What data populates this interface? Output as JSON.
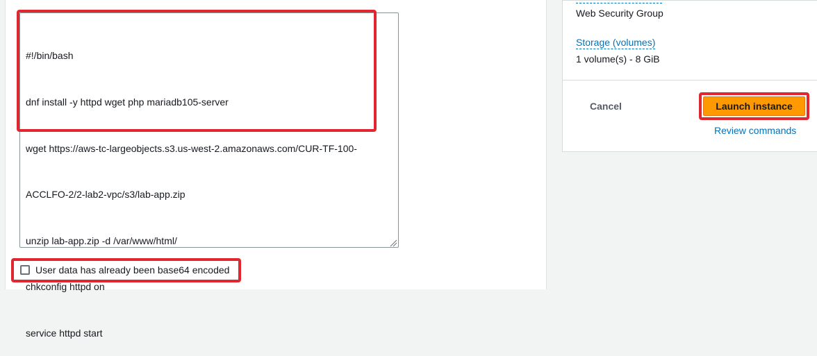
{
  "user_data": {
    "lines": [
      "#!/bin/bash",
      "dnf install -y httpd wget php mariadb105-server",
      "wget https://aws-tc-largeobjects.s3.us-west-2.amazonaws.com/CUR-TF-100-",
      "ACCLFO-2/2-lab2-vpc/s3/lab-app.zip",
      "unzip lab-app.zip -d /var/www/html/",
      "chkconfig httpd on",
      "service httpd start"
    ],
    "base64_checkbox": {
      "label": "User data has already been base64 encoded",
      "checked": false
    }
  },
  "summary": {
    "security_group_value": "Web Security Group",
    "storage_label": "Storage (volumes)",
    "storage_value": "1 volume(s) - 8 GiB",
    "cancel_label": "Cancel",
    "launch_label": "Launch instance",
    "review_label": "Review commands"
  },
  "colors": {
    "highlight": "#e0262f",
    "primary_button": "#ff9900",
    "link": "#0073bb"
  }
}
